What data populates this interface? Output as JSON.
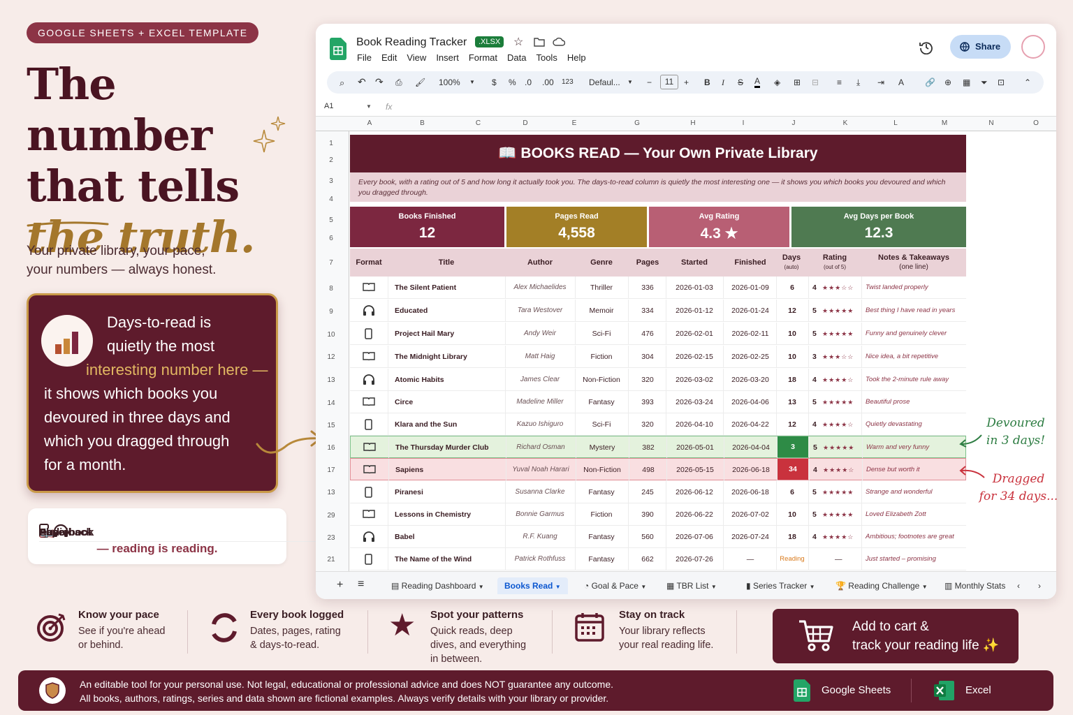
{
  "badge": "GOOGLE SHEETS + EXCEL TEMPLATE",
  "headline": {
    "line1": "The number",
    "line2": "that tells",
    "line3": "the truth."
  },
  "tagline": {
    "line1": "Your private library, your pace,",
    "line2": "your numbers — always honest."
  },
  "callout": {
    "line1": "Days-to-read is",
    "line2": "quietly the most",
    "line3": "interesting number here —",
    "line4": "it shows which books you",
    "line5": "devoured in three days and",
    "line6": "which you dragged through",
    "line7": "for a month."
  },
  "formats": {
    "paperback": "Paperback",
    "ebook": "Ebook",
    "audiobook": "Audiobook",
    "sub": "— reading is reading."
  },
  "sheet": {
    "doc_title": "Book Reading Tracker",
    "file_badge": ".XLSX",
    "menus": [
      "File",
      "Edit",
      "View",
      "Insert",
      "Format",
      "Data",
      "Tools",
      "Help"
    ],
    "share": "Share",
    "toolbar": {
      "zoom": "100%",
      "currency": "$",
      "percent": "%",
      "dec_less": ".0",
      "dec_more": ".00",
      "num": "123",
      "font": "Defaul...",
      "font_size": "11",
      "bold": "B",
      "italic": "I"
    },
    "name_box": "A1",
    "fx": "fx",
    "columns": [
      "A",
      "B",
      "C",
      "D",
      "E",
      "G",
      "H",
      "I",
      "J",
      "K",
      "L",
      "M",
      "N",
      "O"
    ],
    "row_numbers": [
      "1",
      "2",
      "3",
      "4",
      "5",
      "6",
      "7",
      "8",
      "9",
      "10",
      "12",
      "13",
      "14",
      "15",
      "16",
      "17",
      "13",
      "29",
      "23",
      "21"
    ],
    "title": "📖  BOOKS READ — Your Own Private Library",
    "description": "Every book, with a rating out of 5 and how long it actually took you. The days-to-read column is quietly the most interesting one — it shows you which books you devoured and which you dragged through.",
    "kpis": [
      {
        "label": "Books Finished",
        "value": "12",
        "color": "#7c2740"
      },
      {
        "label": "Pages Read",
        "value": "4,558",
        "color": "#a37f26"
      },
      {
        "label": "Avg Rating",
        "value": "4.3 ★",
        "color": "#b85f74"
      },
      {
        "label": "Avg Days per Book",
        "value": "12.3",
        "color": "#4f7a51"
      }
    ],
    "headers": {
      "format": "Format",
      "title": "Title",
      "author": "Author",
      "genre": "Genre",
      "pages": "Pages",
      "started": "Started",
      "finished": "Finished",
      "days": "Days",
      "days_sub": "(auto)",
      "rating": "Rating",
      "rating_sub": "(out of 5)",
      "notes": "Notes & Takeaways",
      "notes_sub": "(one line)"
    },
    "books": [
      {
        "format": "book",
        "title": "The Silent Patient",
        "author": "Alex Michaelides",
        "genre": "Thriller",
        "pages": "336",
        "started": "2026-01-03",
        "finished": "2026-01-09",
        "days": "6",
        "rating": "4",
        "stars": "★★★☆☆",
        "note": "Twist landed properly"
      },
      {
        "format": "audio",
        "title": "Educated",
        "author": "Tara Westover",
        "genre": "Memoir",
        "pages": "334",
        "started": "2026-01-12",
        "finished": "2026-01-24",
        "days": "12",
        "rating": "5",
        "stars": "★★★★★",
        "note": "Best thing I have read in years"
      },
      {
        "format": "ebook",
        "title": "Project Hail Mary",
        "author": "Andy Weir",
        "genre": "Sci-Fi",
        "pages": "476",
        "started": "2026-02-01",
        "finished": "2026-02-11",
        "days": "10",
        "rating": "5",
        "stars": "★★★★★",
        "note": "Funny and genuinely clever"
      },
      {
        "format": "book",
        "title": "The Midnight Library",
        "author": "Matt Haig",
        "genre": "Fiction",
        "pages": "304",
        "started": "2026-02-15",
        "finished": "2026-02-25",
        "days": "10",
        "rating": "3",
        "stars": "★★★☆☆",
        "note": "Nice idea, a bit repetitive"
      },
      {
        "format": "audio",
        "title": "Atomic Habits",
        "author": "James Clear",
        "genre": "Non-Fiction",
        "pages": "320",
        "started": "2026-03-02",
        "finished": "2026-03-20",
        "days": "18",
        "rating": "4",
        "stars": "★★★★☆",
        "note": "Took the 2-minute rule away"
      },
      {
        "format": "book",
        "title": "Circe",
        "author": "Madeline Miller",
        "genre": "Fantasy",
        "pages": "393",
        "started": "2026-03-24",
        "finished": "2026-04-06",
        "days": "13",
        "rating": "5",
        "stars": "★★★★★",
        "note": "Beautiful prose"
      },
      {
        "format": "ebook",
        "title": "Klara and the Sun",
        "author": "Kazuo Ishiguro",
        "genre": "Sci-Fi",
        "pages": "320",
        "started": "2026-04-10",
        "finished": "2026-04-22",
        "days": "12",
        "rating": "4",
        "stars": "★★★★☆",
        "note": "Quietly devastating"
      },
      {
        "format": "book",
        "title": "The Thursday Murder Club",
        "author": "Richard Osman",
        "genre": "Mystery",
        "pages": "382",
        "started": "2026-05-01",
        "finished": "2026-04-04",
        "days": "3",
        "rating": "5",
        "stars": "★★★★★",
        "note": "Warm and very funny",
        "hl": "fast"
      },
      {
        "format": "book",
        "title": "Sapiens",
        "author": "Yuval Noah Harari",
        "genre": "Non-Fiction",
        "pages": "498",
        "started": "2026-05-15",
        "finished": "2026-06-18",
        "days": "34",
        "rating": "4",
        "stars": "★★★★☆",
        "note": "Dense but worth it",
        "hl": "slow"
      },
      {
        "format": "ebook",
        "title": "Piranesi",
        "author": "Susanna Clarke",
        "genre": "Fantasy",
        "pages": "245",
        "started": "2026-06-12",
        "finished": "2026-06-18",
        "days": "6",
        "rating": "5",
        "stars": "★★★★★",
        "note": "Strange and wonderful"
      },
      {
        "format": "book",
        "title": "Lessons in Chemistry",
        "author": "Bonnie Garmus",
        "genre": "Fiction",
        "pages": "390",
        "started": "2026-06-22",
        "finished": "2026-07-02",
        "days": "10",
        "rating": "5",
        "stars": "★★★★★",
        "note": "Loved Elizabeth Zott"
      },
      {
        "format": "audio",
        "title": "Babel",
        "author": "R.F. Kuang",
        "genre": "Fantasy",
        "pages": "560",
        "started": "2026-07-06",
        "finished": "2026-07-24",
        "days": "18",
        "rating": "4",
        "stars": "★★★★☆",
        "note": "Ambitious; footnotes are great"
      },
      {
        "format": "ebook",
        "title": "The Name of the Wind",
        "author": "Patrick Rothfuss",
        "genre": "Fantasy",
        "pages": "662",
        "started": "2026-07-26",
        "finished": "—",
        "days": "Reading",
        "rating": "—",
        "stars": "",
        "note": "Just started – promising"
      }
    ],
    "tabs": [
      "Reading Dashboard",
      "Books Read",
      "Goal & Pace",
      "TBR List",
      "Series Tracker",
      "Reading Challenge",
      "Monthly Stats"
    ]
  },
  "annotations": {
    "fast1": "Devoured",
    "fast2": "in 3 days!",
    "slow1": "Dragged",
    "slow2": "for 34 days..."
  },
  "features": [
    {
      "title": "Know your pace",
      "d1": "See if you're ahead",
      "d2": "or behind.",
      "d3": ""
    },
    {
      "title": "Every book logged",
      "d1": "Dates, pages, rating",
      "d2": "& days-to-read.",
      "d3": ""
    },
    {
      "title": "Spot your patterns",
      "d1": "Quick reads, deep",
      "d2": "dives, and everything",
      "d3": "in between."
    },
    {
      "title": "Stay on track",
      "d1": "Your library reflects",
      "d2": "your real reading life.",
      "d3": ""
    }
  ],
  "cta": {
    "line1": "Add to cart &",
    "line2": "track your reading life ✨"
  },
  "footer": {
    "line1": "An editable tool for your personal use. Not legal, educational or professional advice and does NOT guarantee any outcome.",
    "line2": "All books, authors, ratings, series and data shown are fictional examples. Always verify details with your library or provider.",
    "gs": "Google Sheets",
    "excel": "Excel"
  },
  "colors": {
    "maroon": "#5e1b2c",
    "gold": "#a4772c",
    "green": "#2e8b46",
    "red": "#c9323d"
  }
}
